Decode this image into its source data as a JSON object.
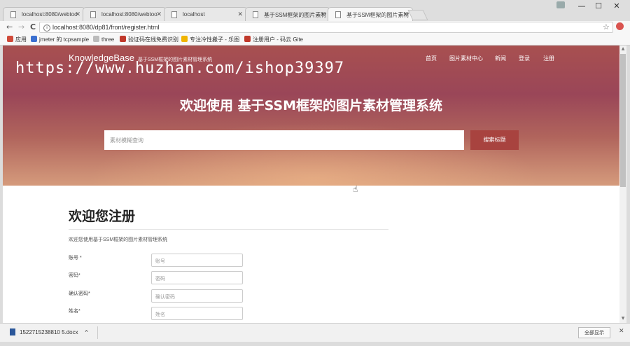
{
  "browser": {
    "tabs": [
      {
        "label": "localhost:8080/webtoo"
      },
      {
        "label": "localhost:8080/webtoo"
      },
      {
        "label": "localhost"
      },
      {
        "label": "基于SSM框架的图片素材"
      },
      {
        "label": "基于SSM框架的图片素材"
      }
    ],
    "window_controls": {
      "minimize": "—",
      "maximize": "☐",
      "close": "✕"
    },
    "nav": {
      "back": "←",
      "forward": "→",
      "reload": "C"
    },
    "address": "localhost:8080/dp81/front/register.html",
    "star": "☆",
    "bookmarks": [
      {
        "label": "应用",
        "color": "#d04a3a"
      },
      {
        "label": "jmeter 的 tcpsample",
        "color": "#3a6fd0"
      },
      {
        "label": "three",
        "color": "#777777"
      },
      {
        "label": "验证码在线免费识别",
        "color": "#c0392b"
      },
      {
        "label": "专注冷性搬子 - 乐图",
        "color": "#f0b400"
      },
      {
        "label": "注册用户 - 码云 Gite",
        "color": "#c0392b"
      }
    ]
  },
  "page": {
    "brand": "KnowledgeBase",
    "brand_sub": "基于SSM框架的图片素材管理系统",
    "nav": [
      "首页",
      "图片素材中心",
      "新闻",
      "登录",
      "注册"
    ],
    "watermark": "https://www.huzhan.com/ishop39397",
    "hero_title": "欢迎使用 基于SSM框架的图片素材管理系统",
    "search_placeholder": "素材模糊查询",
    "search_button": "搜索标题",
    "register_title": "欢迎您注册",
    "register_sub": "欢迎您使用基于SSM框架的图片素材管理系统",
    "fields": [
      {
        "label": "账号 *",
        "placeholder": "账号"
      },
      {
        "label": "密码*",
        "placeholder": "密码"
      },
      {
        "label": "确认密码*",
        "placeholder": "确认密码"
      },
      {
        "label": "姓名*",
        "placeholder": "姓名"
      }
    ]
  },
  "download_bar": {
    "file": "1522715238810 5.docx",
    "chevron": "^",
    "show_all": "全部显示",
    "close": "✕"
  }
}
